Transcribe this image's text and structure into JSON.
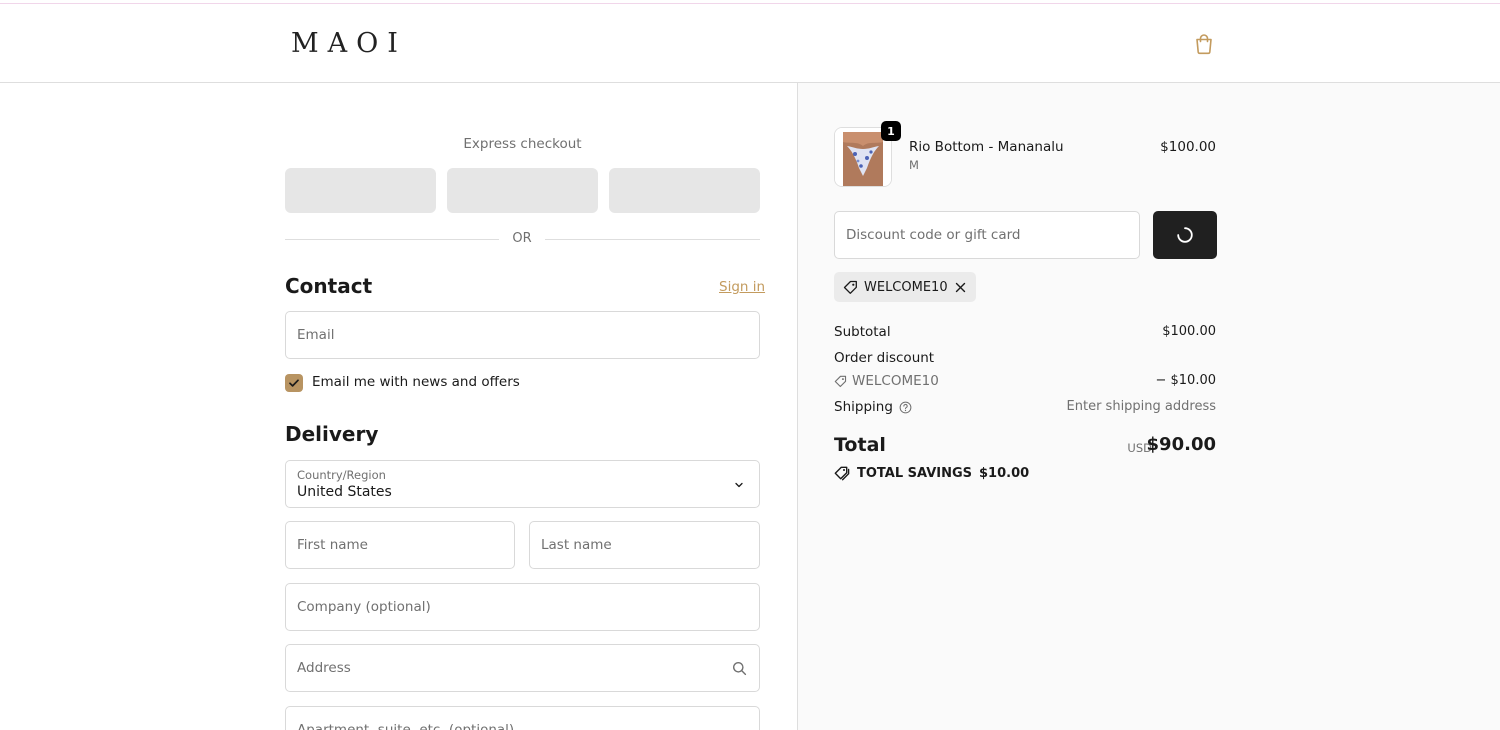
{
  "brand": {
    "logo_text": "MAOI",
    "accent_color": "#c39b5e",
    "checkbox_color": "#b89462"
  },
  "header": {
    "cart_icon": "shopping-bag-icon"
  },
  "express_checkout": {
    "title": "Express checkout",
    "separator": "OR"
  },
  "contact": {
    "heading": "Contact",
    "sign_in_link": "Sign in",
    "email_placeholder": "Email",
    "newsletter_label": "Email me with news and offers",
    "newsletter_checked": true
  },
  "delivery": {
    "heading": "Delivery",
    "country_label": "Country/Region",
    "country_value": "United States",
    "first_name_placeholder": "First name",
    "last_name_placeholder": "Last name",
    "company_placeholder": "Company (optional)",
    "address_placeholder": "Address",
    "apartment_placeholder": "Apartment, suite, etc. (optional)"
  },
  "order": {
    "line_items": [
      {
        "quantity": "1",
        "name": "Rio Bottom - Mananalu",
        "variant": "M",
        "price": "$100.00"
      }
    ],
    "discount_placeholder": "Discount code or gift card",
    "applied_code": "WELCOME10",
    "subtotal_label": "Subtotal",
    "subtotal_value": "$100.00",
    "order_discount_label": "Order discount",
    "discount_code": "WELCOME10",
    "discount_value": "− $10.00",
    "shipping_label": "Shipping",
    "shipping_value": "Enter shipping address",
    "total_label": "Total",
    "total_currency": "USD",
    "total_value": "$90.00",
    "savings_label": "TOTAL SAVINGS",
    "savings_value": "$10.00"
  }
}
